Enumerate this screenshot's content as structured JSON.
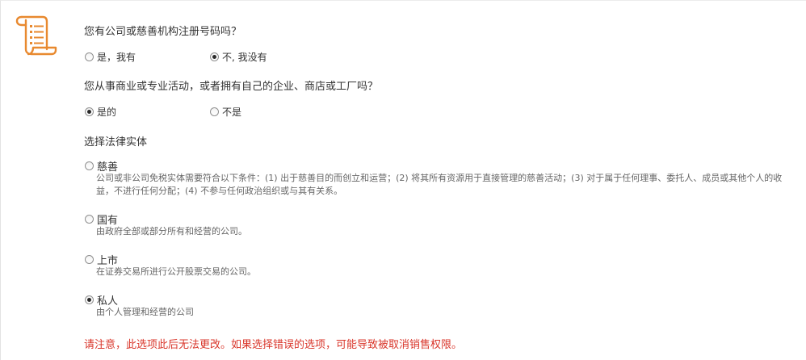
{
  "icon": {
    "name": "document-scroll-icon",
    "color": "#e8892f"
  },
  "q1": {
    "text": "您有公司或慈善机构注册号码吗？",
    "options": [
      {
        "label": "是，我有",
        "checked": false
      },
      {
        "label": "不, 我没有",
        "checked": true
      }
    ]
  },
  "q2": {
    "text": "您从事商业或专业活动，或者拥有自己的企业、商店或工厂吗？",
    "options": [
      {
        "label": "是的",
        "checked": true
      },
      {
        "label": "不是",
        "checked": false
      }
    ]
  },
  "legal": {
    "heading": "选择法律实体",
    "options": [
      {
        "title": "慈善",
        "checked": false,
        "desc_line1": "公司或非公司免税实体需要符合以下条件：(1) 出于慈善目的而创立和运营；(2) 将其所有资源用于直接管理的慈善活动；(3) 对于属于任何理事、委托人、成员或其他个人的收",
        "desc_line2": "益，不进行任何分配；(4) 不参与任何政治组织或与其有关系。"
      },
      {
        "title": "国有",
        "checked": false,
        "desc_line1": "由政府全部或部分所有和经营的公司。"
      },
      {
        "title": "上市",
        "checked": false,
        "desc_line1": "在证券交易所进行公开股票交易的公司。"
      },
      {
        "title": "私人",
        "checked": true,
        "desc_line1": "由个人管理和经营的公司"
      }
    ]
  },
  "warning": {
    "text": "请注意，此选项此后无法更改。如果选择错误的选项，可能导致被取消销售权限。",
    "color": "#d9352a"
  }
}
